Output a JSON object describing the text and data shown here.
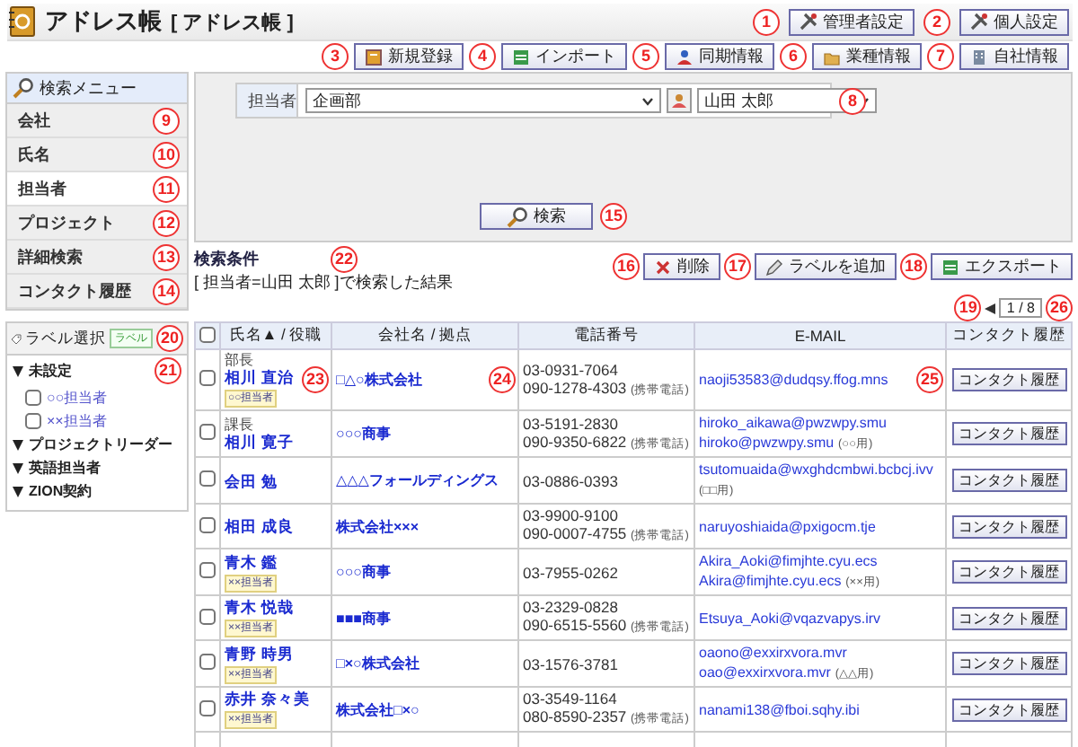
{
  "app": {
    "title": "アドレス帳",
    "subtitle": "[ アドレス帳 ]"
  },
  "top_buttons": [
    "管理者設定",
    "個人設定"
  ],
  "toolbar_buttons": [
    "新規登録",
    "インポート",
    "同期情報",
    "業種情報",
    "自社情報"
  ],
  "search_menu": {
    "title": "検索メニュー",
    "items": [
      {
        "label": "会社",
        "selected": false
      },
      {
        "label": "氏名",
        "selected": false
      },
      {
        "label": "担当者",
        "selected": true
      },
      {
        "label": "プロジェクト",
        "selected": false
      },
      {
        "label": "詳細検索",
        "selected": false
      },
      {
        "label": "コンタクト履歴",
        "selected": false
      }
    ]
  },
  "search_form": {
    "field_label": "担当者",
    "department": "企画部",
    "person": "山田 太郎",
    "search_button": "検索"
  },
  "conditions": {
    "title": "検索条件",
    "text": "[ 担当者=山田 太郎 ]で検索した結果"
  },
  "actions": [
    "削除",
    "ラベルを追加",
    "エクスポート"
  ],
  "pagination": "1 / 8",
  "labels": {
    "title": "ラベル選択",
    "tag": "ラベル",
    "groups": [
      {
        "label": "未設定",
        "expanded": true,
        "children": [
          {
            "label": "○○担当者",
            "checked": false
          },
          {
            "label": "××担当者",
            "checked": false
          }
        ]
      },
      {
        "label": "プロジェクトリーダー",
        "expanded": true
      },
      {
        "label": "英語担当者",
        "expanded": true
      },
      {
        "label": "ZION契約",
        "expanded": true
      }
    ]
  },
  "table": {
    "select_all_checked": false,
    "columns": [
      "氏名▲ / 役職",
      "会社名 / 拠点",
      "電話番号",
      "E-MAIL",
      "コンタクト履歴"
    ],
    "rows": [
      {
        "checked": false,
        "title": "部長",
        "name": "相川 直治",
        "tag": "○○担当者",
        "company": "□△○株式会社",
        "phones": [
          {
            "number": "03-0931-7064"
          },
          {
            "number": "090-1278-4303",
            "note": "(携帯電話)"
          }
        ],
        "emails": [
          {
            "address": "naoji53583@dudqsy.ffog.mns"
          }
        ],
        "history": "コンタクト履歴"
      },
      {
        "checked": false,
        "title": "課長",
        "name": "相川 寛子",
        "company": "○○○商事",
        "phones": [
          {
            "number": "03-5191-2830"
          },
          {
            "number": "090-9350-6822",
            "note": "(携帯電話)"
          }
        ],
        "emails": [
          {
            "address": "hiroko_aikawa@pwzwpy.smu"
          },
          {
            "address": "hiroko@pwzwpy.smu",
            "note": "(○○用)"
          }
        ],
        "history": "コンタクト履歴"
      },
      {
        "checked": false,
        "name": "会田 勉",
        "company": "△△△フォールディングス",
        "phones": [
          {
            "number": "03-0886-0393"
          }
        ],
        "emails": [
          {
            "address": "tsutomuaida@wxghdcmbwi.bcbcj.ivv",
            "note": "(□□用)"
          }
        ],
        "history": "コンタクト履歴"
      },
      {
        "checked": false,
        "name": "相田 成良",
        "company": "株式会社×××",
        "phones": [
          {
            "number": "03-9900-9100"
          },
          {
            "number": "090-0007-4755",
            "note": "(携帯電話)"
          }
        ],
        "emails": [
          {
            "address": "naruyoshiaida@pxigocm.tje"
          }
        ],
        "history": "コンタクト履歴"
      },
      {
        "checked": false,
        "name": "青木 鑑",
        "tag": "××担当者",
        "company": "○○○商事",
        "phones": [
          {
            "number": "03-7955-0262"
          }
        ],
        "emails": [
          {
            "address": "Akira_Aoki@fimjhte.cyu.ecs"
          },
          {
            "address": "Akira@fimjhte.cyu.ecs",
            "note": "(××用)"
          }
        ],
        "history": "コンタクト履歴"
      },
      {
        "checked": false,
        "name": "青木 悦哉",
        "tag": "××担当者",
        "company": "■■■商事",
        "phones": [
          {
            "number": "03-2329-0828"
          },
          {
            "number": "090-6515-5560",
            "note": "(携帯電話)"
          }
        ],
        "emails": [
          {
            "address": "Etsuya_Aoki@vqazvapys.irv"
          }
        ],
        "history": "コンタクト履歴"
      },
      {
        "checked": false,
        "name": "青野 時男",
        "tag": "××担当者",
        "company": "□×○株式会社",
        "phones": [
          {
            "number": "03-1576-3781"
          }
        ],
        "emails": [
          {
            "address": "oaono@exxirxvora.mvr"
          },
          {
            "address": "oao@exxirxvora.mvr",
            "note": "(△△用)"
          }
        ],
        "history": "コンタクト履歴"
      },
      {
        "checked": false,
        "name": "赤井 奈々美",
        "tag": "××担当者",
        "company": "株式会社□×○",
        "phones": [
          {
            "number": "03-3549-1164"
          },
          {
            "number": "080-8590-2357",
            "note": "(携帯電話)"
          }
        ],
        "emails": [
          {
            "address": "nanami138@fboi.sqhy.ibi"
          }
        ],
        "history": "コンタクト履歴"
      }
    ]
  },
  "annotations": [
    "1",
    "2",
    "3",
    "4",
    "5",
    "6",
    "7",
    "8",
    "9",
    "10",
    "11",
    "12",
    "13",
    "14",
    "15",
    "16",
    "17",
    "18",
    "19",
    "20",
    "21",
    "22",
    "23",
    "24",
    "25",
    "26"
  ]
}
